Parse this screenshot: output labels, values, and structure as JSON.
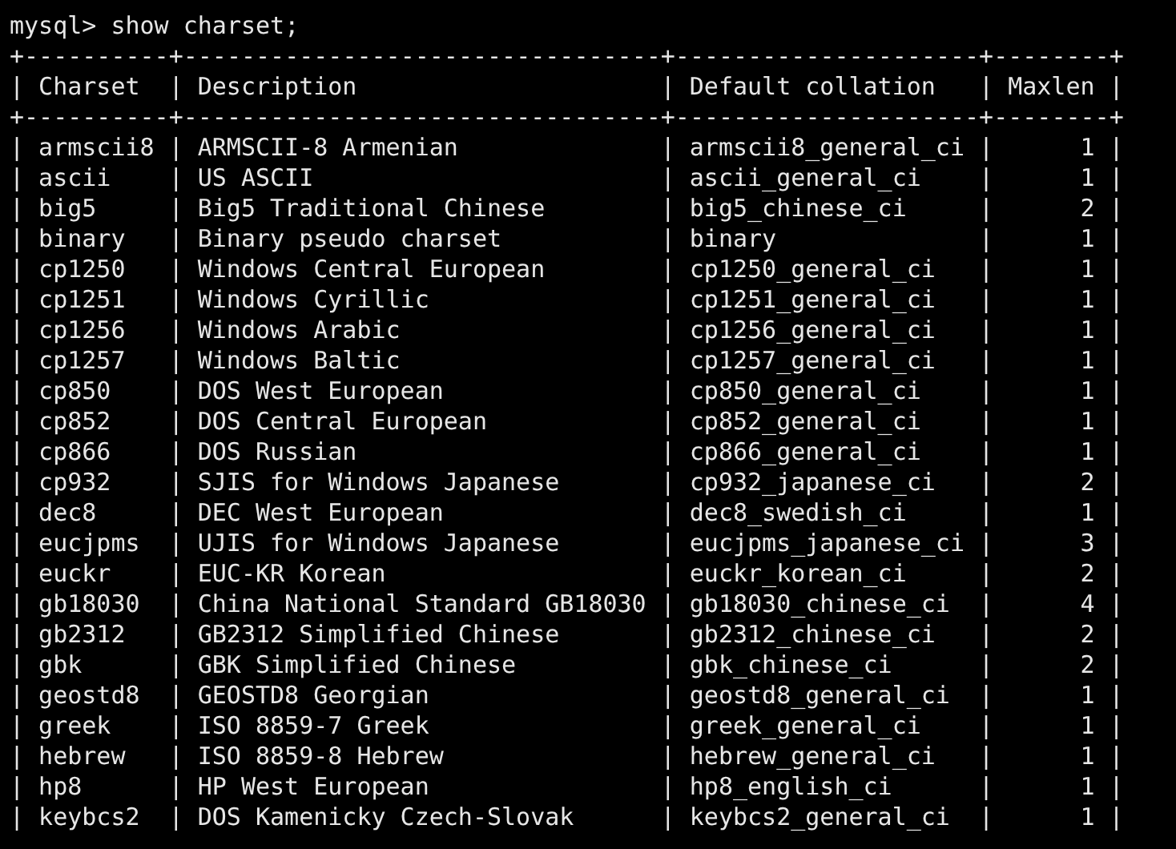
{
  "prompt": "mysql> show charset;",
  "border": "+----------+---------------------------------+---------------------+--------+",
  "separator": "|",
  "columns": [
    "Charset",
    "Description",
    "Default collation",
    "Maxlen"
  ],
  "rows": [
    [
      "armscii8",
      "ARMSCII-8 Armenian",
      "armscii8_general_ci",
      "1"
    ],
    [
      "ascii",
      "US ASCII",
      "ascii_general_ci",
      "1"
    ],
    [
      "big5",
      "Big5 Traditional Chinese",
      "big5_chinese_ci",
      "2"
    ],
    [
      "binary",
      "Binary pseudo charset",
      "binary",
      "1"
    ],
    [
      "cp1250",
      "Windows Central European",
      "cp1250_general_ci",
      "1"
    ],
    [
      "cp1251",
      "Windows Cyrillic",
      "cp1251_general_ci",
      "1"
    ],
    [
      "cp1256",
      "Windows Arabic",
      "cp1256_general_ci",
      "1"
    ],
    [
      "cp1257",
      "Windows Baltic",
      "cp1257_general_ci",
      "1"
    ],
    [
      "cp850",
      "DOS West European",
      "cp850_general_ci",
      "1"
    ],
    [
      "cp852",
      "DOS Central European",
      "cp852_general_ci",
      "1"
    ],
    [
      "cp866",
      "DOS Russian",
      "cp866_general_ci",
      "1"
    ],
    [
      "cp932",
      "SJIS for Windows Japanese",
      "cp932_japanese_ci",
      "2"
    ],
    [
      "dec8",
      "DEC West European",
      "dec8_swedish_ci",
      "1"
    ],
    [
      "eucjpms",
      "UJIS for Windows Japanese",
      "eucjpms_japanese_ci",
      "3"
    ],
    [
      "euckr",
      "EUC-KR Korean",
      "euckr_korean_ci",
      "2"
    ],
    [
      "gb18030",
      "China National Standard GB18030",
      "gb18030_chinese_ci",
      "4"
    ],
    [
      "gb2312",
      "GB2312 Simplified Chinese",
      "gb2312_chinese_ci",
      "2"
    ],
    [
      "gbk",
      "GBK Simplified Chinese",
      "gbk_chinese_ci",
      "2"
    ],
    [
      "geostd8",
      "GEOSTD8 Georgian",
      "geostd8_general_ci",
      "1"
    ],
    [
      "greek",
      "ISO 8859-7 Greek",
      "greek_general_ci",
      "1"
    ],
    [
      "hebrew",
      "ISO 8859-8 Hebrew",
      "hebrew_general_ci",
      "1"
    ],
    [
      "hp8",
      "HP West European",
      "hp8_english_ci",
      "1"
    ],
    [
      "keybcs2",
      "DOS Kamenicky Czech-Slovak",
      "keybcs2_general_ci",
      "1"
    ]
  ]
}
